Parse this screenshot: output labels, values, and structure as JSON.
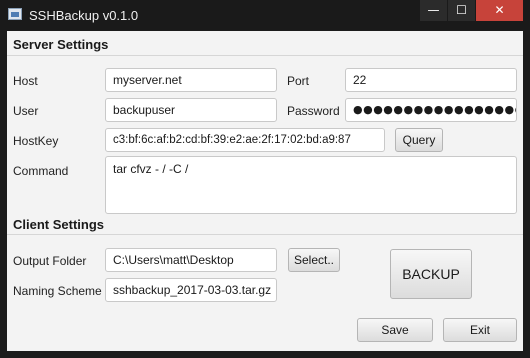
{
  "window": {
    "title": "SSHBackup v0.1.0"
  },
  "controls": {
    "minimize": "—",
    "maximize": "☐",
    "close": "✕"
  },
  "server": {
    "heading": "Server Settings",
    "host_label": "Host",
    "host_value": "myserver.net",
    "port_label": "Port",
    "port_value": "22",
    "user_label": "User",
    "user_value": "backupuser",
    "password_label": "Password",
    "password_value": "●●●●●●●●●●●●●●●●●●●●",
    "hostkey_label": "HostKey",
    "hostkey_value": "c3:bf:6c:af:b2:cd:bf:39:e2:ae:2f:17:02:bd:a9:87",
    "query_button": "Query",
    "command_label": "Command",
    "command_value": "tar cfvz - / -C /"
  },
  "client": {
    "heading": "Client Settings",
    "output_label": "Output Folder",
    "output_value": "C:\\Users\\matt\\Desktop",
    "select_button": "Select..",
    "naming_label": "Naming Scheme",
    "naming_value": "sshbackup_2017-03-03.tar.gz",
    "backup_button": "BACKUP"
  },
  "footer": {
    "save_button": "Save",
    "exit_button": "Exit"
  }
}
